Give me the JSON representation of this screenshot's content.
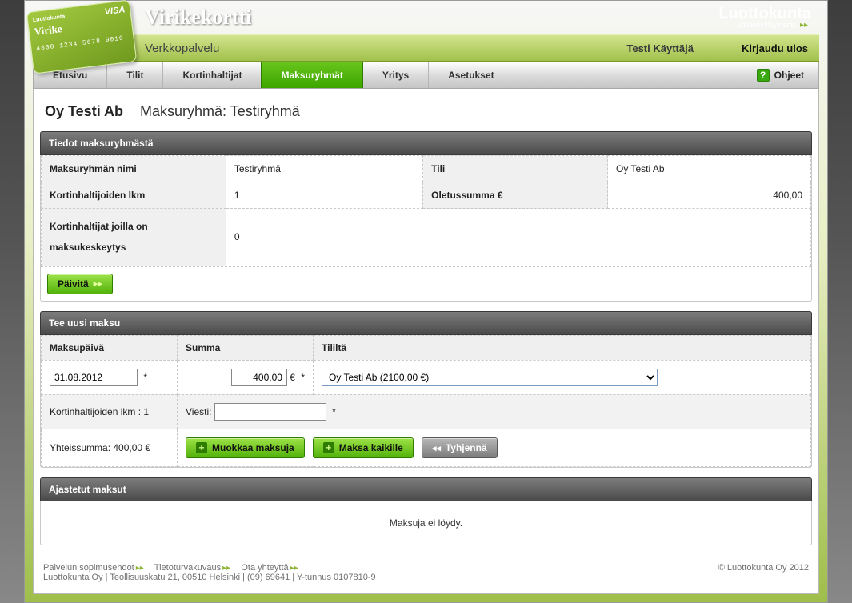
{
  "brand": {
    "app_title": "Virikekortti",
    "subtitle": "Verkkopalvelu",
    "card": {
      "brand_small": "Luottokunta",
      "name": "Virike",
      "number": "4800 1234 5678 9010",
      "visa": "VISA"
    },
    "company_logo": {
      "line1": "Luottokunta",
      "line2": "Efficient Payments"
    }
  },
  "header": {
    "user": "Testi Käyttäjä",
    "logout": "Kirjaudu ulos"
  },
  "nav": {
    "tabs": [
      {
        "label": "Etusivu"
      },
      {
        "label": "Tilit"
      },
      {
        "label": "Kortinhaltijat"
      },
      {
        "label": "Maksuryhmät",
        "active": true
      },
      {
        "label": "Yritys"
      },
      {
        "label": "Asetukset"
      }
    ],
    "help": "Ohjeet"
  },
  "page": {
    "company": "Oy Testi Ab",
    "breadcrumb": "Maksuryhmä: Testiryhmä"
  },
  "info_panel": {
    "title": "Tiedot maksuryhmästä",
    "rows": {
      "name_label": "Maksuryhmän nimi",
      "name_value": "Testiryhmä",
      "account_label": "Tili",
      "account_value": "Oy Testi Ab",
      "holders_label": "Kortinhaltijoiden lkm",
      "holders_value": "1",
      "default_label": "Oletussumma €",
      "default_value": "400,00",
      "suspended_label": "Kortinhaltijat joilla on maksukeskeytys",
      "suspended_value": "0"
    },
    "update_btn": "Päivitä"
  },
  "payment_panel": {
    "title": "Tee uusi maksu",
    "columns": {
      "date": "Maksupäivä",
      "amount": "Summa",
      "from": "Tililtä"
    },
    "form": {
      "date_value": "31.08.2012",
      "amount_value": "400,00",
      "currency": "€",
      "required": "*",
      "from_option": "Oy Testi Ab (2100,00 €)",
      "holders_text": "Kortinhaltijoiden lkm : 1",
      "message_label": "Viesti:",
      "message_value": "",
      "total_text": "Yhteissumma: 400,00 €"
    },
    "buttons": {
      "edit": "Muokkaa maksuja",
      "pay_all": "Maksa kaikille",
      "clear": "Tyhjennä"
    }
  },
  "scheduled_panel": {
    "title": "Ajastetut maksut",
    "empty": "Maksuja ei löydy."
  },
  "footer": {
    "links": {
      "terms": "Palvelun sopimusehdot",
      "security": "Tietoturvakuvaus",
      "contact": "Ota yhteyttä"
    },
    "address": "Luottokunta Oy | Teollisuuskatu 21, 00510 Helsinki | (09) 69641 | Y-tunnus 0107810-9",
    "copyright": "© Luottokunta Oy 2012"
  }
}
